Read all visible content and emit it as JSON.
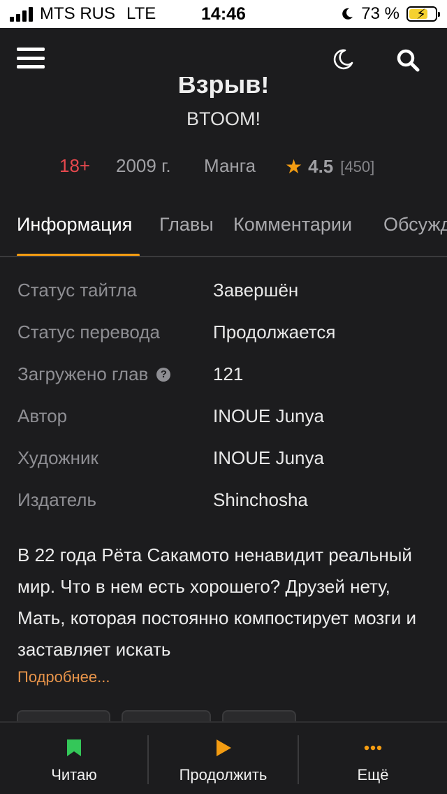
{
  "status_bar": {
    "carrier": "MTS RUS",
    "network": "LTE",
    "time": "14:46",
    "battery_percent": "73 %",
    "battery_level": 0.73,
    "icons": [
      "signal-icon",
      "moon-icon",
      "battery-charging-icon"
    ]
  },
  "app_bar": {
    "icons": [
      "hamburger-menu-icon",
      "night-mode-moon-icon",
      "search-icon"
    ]
  },
  "title": {
    "localized_cut": "Взрыв!",
    "original": "BTOOM!"
  },
  "meta": {
    "age_rating": "18+",
    "year": "2009 г.",
    "type": "Манга",
    "rating": "4.5",
    "rating_count": "[450]",
    "age_color": "#e5484d"
  },
  "tabs": [
    {
      "label": "Информация",
      "active": true
    },
    {
      "label": "Главы",
      "active": false
    },
    {
      "label": "Комментарии",
      "active": false
    },
    {
      "label": "Обсуждения",
      "active": false
    }
  ],
  "accent_color": "#f39c12",
  "info": [
    {
      "key": "Статус тайтла",
      "value": "Завершён"
    },
    {
      "key": "Статус перевода",
      "value": "Продолжается"
    },
    {
      "key": "Загружено глав",
      "value": "121"
    },
    {
      "key": "Автор",
      "value": "INOUE Junya"
    },
    {
      "key": "Художник",
      "value": "INOUE Junya"
    },
    {
      "key": "Издатель",
      "value": "Shinchosha"
    }
  ],
  "description": "В 22 года Рёта Сакамото ненавидит реальный мир. Что в нем есть хорошего? Друзей нету, Мать, которая постоянно компостирует мозги и заставляет искать",
  "more_link": "Подробнее...",
  "bottom_nav": [
    {
      "label": "Читаю",
      "icon": "bookmark-icon",
      "color": "#34c759"
    },
    {
      "label": "Продолжить",
      "icon": "play-icon",
      "color": "#f39c12"
    },
    {
      "label": "Ещё",
      "icon": "more-dots-icon",
      "color": "#f39c12"
    }
  ]
}
